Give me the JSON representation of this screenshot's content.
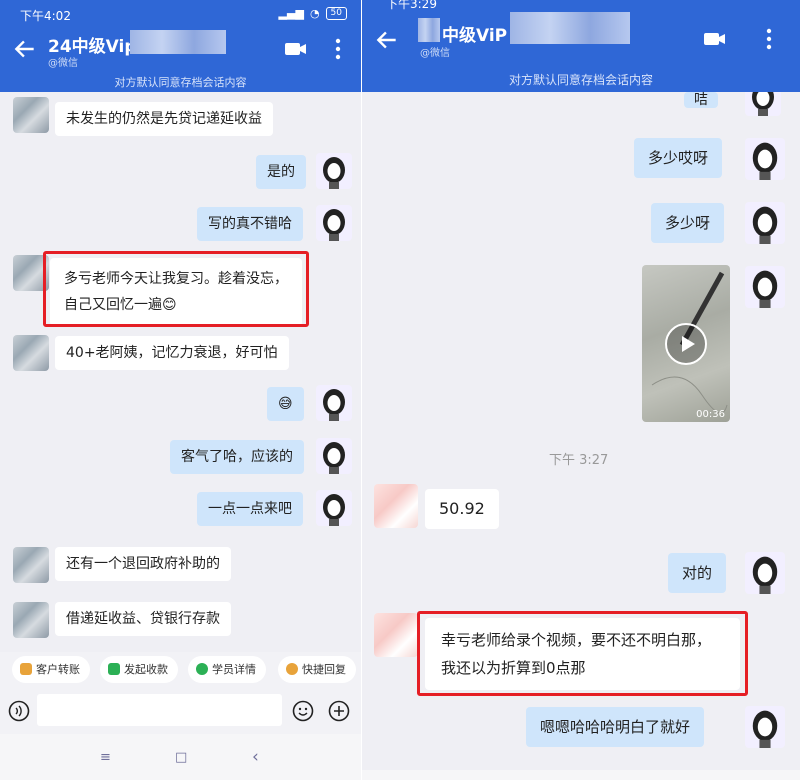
{
  "left": {
    "status_time": "下午4:02",
    "battery": "50",
    "title": "24中级Vip",
    "subtitle": "@微信",
    "notice": "对方默认同意存档会话内容",
    "messages": [
      "未发生的仍然是先贷记递延收益",
      "是的",
      "写的真不错哈",
      "多亏老师今天让我复习。趁着没忘，自己又回忆一遍😊",
      "40+老阿姨，记忆力衰退，好可怕",
      "😅",
      "客气了哈，应该的",
      "一点一点来吧",
      "还有一个退回政府补助的",
      "借递延收益、贷银行存款"
    ],
    "quick_actions": [
      "客户转账",
      "发起收款",
      "学员详情",
      "快捷回复"
    ],
    "quick_colors": [
      "#e8a33a",
      "#2bb055",
      "#2bb055",
      "#e8a33a"
    ],
    "nav": [
      "≡",
      "□",
      "‹"
    ]
  },
  "right": {
    "status_time": "下午3:29",
    "title": "中级ViP",
    "subtitle": "@微信",
    "notice": "对方默认同意存档会话内容",
    "messages": {
      "m0": "咭",
      "m1": "多少哎呀",
      "m2": "多少呀",
      "m3": "50.92",
      "m4": "对的",
      "m5": "幸亏老师给录个视频，要不还不明白那，我还以为折算到0点那",
      "m6": "嗯嗯哈哈哈明白了就好"
    },
    "video_duration": "00:36",
    "time_label": "下午 3:27"
  },
  "colors": {
    "header_blue": "#2f67d6",
    "out_bubble": "#cfe5fb",
    "highlight_red": "#e51e25"
  }
}
